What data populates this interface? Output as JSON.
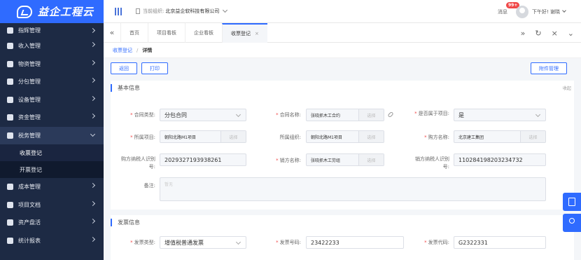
{
  "app": {
    "logo_text": "益企工程云"
  },
  "sidebar": {
    "items": [
      {
        "label": "指辉管理",
        "icon": "doc-icon"
      },
      {
        "label": "收入管理",
        "icon": "income-icon"
      },
      {
        "label": "物资管理",
        "icon": "box-icon"
      },
      {
        "label": "分包管理",
        "icon": "package-icon"
      },
      {
        "label": "设备管理",
        "icon": "device-icon"
      },
      {
        "label": "资金管理",
        "icon": "money-icon"
      },
      {
        "label": "税务管理",
        "icon": "tax-icon"
      }
    ],
    "sub_items": [
      {
        "label": "收票登记"
      },
      {
        "label": "开票登记"
      }
    ],
    "items_after": [
      {
        "label": "成本管理",
        "icon": "chart-icon"
      },
      {
        "label": "项目文档",
        "icon": "cloud-icon"
      },
      {
        "label": "资产盘活",
        "icon": "asset-icon"
      },
      {
        "label": "统计报表",
        "icon": "report-icon"
      }
    ]
  },
  "header": {
    "org_label": "当前组织:",
    "org_name": "北京益企软科技有限公司",
    "msg_label": "消息",
    "msg_badge": "99+",
    "greeting": "下午好! 谢晓"
  },
  "tabs": {
    "left_icon": "«",
    "items": [
      {
        "label": "首页"
      },
      {
        "label": "项目看板"
      },
      {
        "label": "企业看板"
      },
      {
        "label": "收票登记",
        "close": "×"
      }
    ],
    "right_icons": [
      "»",
      "↻",
      "×",
      "⌄"
    ]
  },
  "breadcrumb": {
    "parent": "收票登记",
    "sep": "/",
    "current": "详情"
  },
  "toolbar": {
    "back": "返回",
    "print": "打印",
    "attachments": "附件管理"
  },
  "basic": {
    "title": "基本信息",
    "collapse": "收起",
    "contract_type_label": "合同类型:",
    "contract_type": "分包合同",
    "contract_name_label": "合同名称:",
    "contract_name": "张晓抓木工合约",
    "suffix": "选择",
    "is_project_label": "是否属于项目:",
    "is_project": "是",
    "project_label": "所属项目:",
    "project": "朝阳北路M1项目",
    "org_label": "所属组织:",
    "org": "朝阳北路M1项目",
    "buyer_label": "购方名称:",
    "buyer": "北京建工集团",
    "buyer_tax_label": "购方纳税人识别号:",
    "buyer_tax": "2029327193938261",
    "seller_label": "销方名称:",
    "seller": "张晓抓木工劳组",
    "seller_tax_label": "销方纳税人识别号:",
    "seller_tax": "110284198203234732",
    "remark_label": "备注:",
    "remark_placeholder": "暂无"
  },
  "invoice": {
    "title": "发票信息",
    "collapse": "收起",
    "type_label": "发票类型:",
    "type": "增值税普通发票",
    "number_label": "发票号码:",
    "number": "23422233",
    "code_label": "发票代码:",
    "code": "G2322331"
  }
}
